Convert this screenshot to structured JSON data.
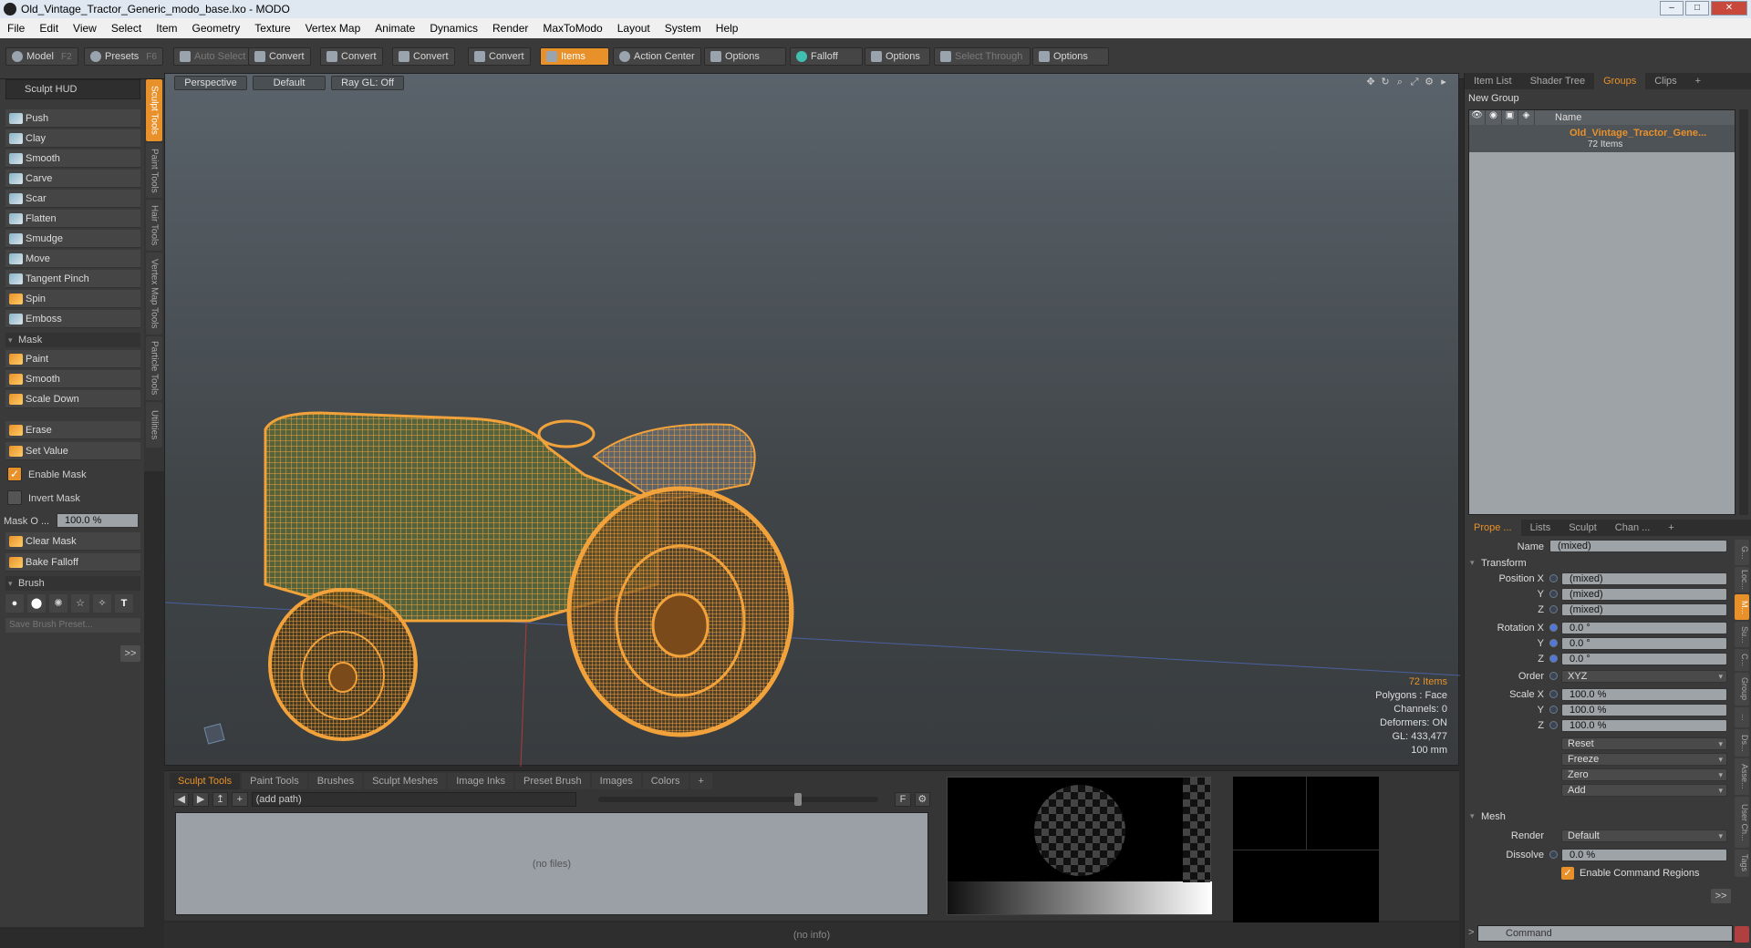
{
  "window": {
    "title": "Old_Vintage_Tractor_Generic_modo_base.lxo - MODO"
  },
  "menu": [
    "File",
    "Edit",
    "View",
    "Select",
    "Item",
    "Geometry",
    "Texture",
    "Vertex Map",
    "Animate",
    "Dynamics",
    "Render",
    "MaxToModo",
    "Layout",
    "System",
    "Help"
  ],
  "toolbar": {
    "model": "Model",
    "model_key": "F2",
    "presets": "Presets",
    "presets_key": "F6",
    "auto_select": "Auto Select",
    "convert1": "Convert",
    "convert2": "Convert",
    "convert3": "Convert",
    "convert4": "Convert",
    "items": "Items",
    "action_center": "Action Center",
    "options1": "Options",
    "falloff": "Falloff",
    "options2": "Options",
    "select_through": "Select Through",
    "options3": "Options"
  },
  "sculpt": {
    "hud": "Sculpt HUD",
    "tools": [
      "Push",
      "Clay",
      "Smooth",
      "Carve",
      "Scar",
      "Flatten",
      "Smudge",
      "Move",
      "Tangent Pinch",
      "Spin",
      "Emboss"
    ],
    "mask_header": "Mask",
    "mask_tools": [
      "Paint",
      "Smooth",
      "Scale Down"
    ],
    "erase": "Erase",
    "set_value": "Set Value",
    "enable_mask": "Enable Mask",
    "invert_mask": "Invert Mask",
    "mask_opacity_label": "Mask O ...",
    "mask_opacity_value": "100.0 %",
    "clear_mask": "Clear Mask",
    "bake_falloff": "Bake Falloff",
    "brush_header": "Brush",
    "brush_preset_placeholder": "Save Brush Preset...",
    "more": ">>"
  },
  "vtabs": [
    "Sculpt Tools",
    "Paint Tools",
    "Hair Tools",
    "Vertex Map Tools",
    "Particle Tools",
    "Utilities"
  ],
  "viewport": {
    "view": "Perspective",
    "shading": "Default",
    "raygl": "Ray GL: Off",
    "info": {
      "items": "72 Items",
      "polygons": "Polygons : Face",
      "channels": "Channels: 0",
      "deformers": "Deformers: ON",
      "gl": "GL: 433,477",
      "scale": "100 mm"
    }
  },
  "bottom": {
    "tabs": [
      "Sculpt Tools",
      "Paint Tools",
      "Brushes",
      "Sculpt Meshes",
      "Image Inks",
      "Preset Brush",
      "Images",
      "Colors",
      "+"
    ],
    "path": "(add path)",
    "no_files": "(no files)",
    "f_label": "F"
  },
  "status": "(no info)",
  "right": {
    "tabs": [
      "Item List",
      "Shader Tree",
      "Groups",
      "Clips",
      "+"
    ],
    "new_group": "New Group",
    "col_name": "Name",
    "group_name": "Old_Vintage_Tractor_Gene...",
    "group_count": "72 Items",
    "prop_tabs": [
      "Prope ...",
      "Lists",
      "Sculpt",
      "Chan ...",
      "+"
    ],
    "name_label": "Name",
    "name_value": "(mixed)",
    "transform": "Transform",
    "position_x_label": "Position X",
    "y_label": "Y",
    "z_label": "Z",
    "pos_x": "(mixed)",
    "pos_y": "(mixed)",
    "pos_z": "(mixed)",
    "rotation_x_label": "Rotation X",
    "rot_x": "0.0 °",
    "rot_y": "0.0 °",
    "rot_z": "0.0 °",
    "order_label": "Order",
    "order_value": "XYZ",
    "scale_x_label": "Scale X",
    "scale_x": "100.0 %",
    "scale_y": "100.0 %",
    "scale_z": "100.0 %",
    "reset": "Reset",
    "freeze": "Freeze",
    "zero": "Zero",
    "add": "Add",
    "mesh": "Mesh",
    "render_label": "Render",
    "render_value": "Default",
    "dissolve_label": "Dissolve",
    "dissolve_value": "0.0 %",
    "enable_cmd_regions": "Enable Command Regions",
    "more": ">>",
    "command_placeholder": "Command",
    "side_tabs": [
      "G...",
      "Loc...",
      "M...",
      "Su...",
      "C...",
      "Group",
      "...",
      "Ds...",
      "Asse...",
      "User Ch...",
      "Tags"
    ]
  },
  "colors": {
    "accent": "#e8912a",
    "wire": "#f2a23a"
  }
}
